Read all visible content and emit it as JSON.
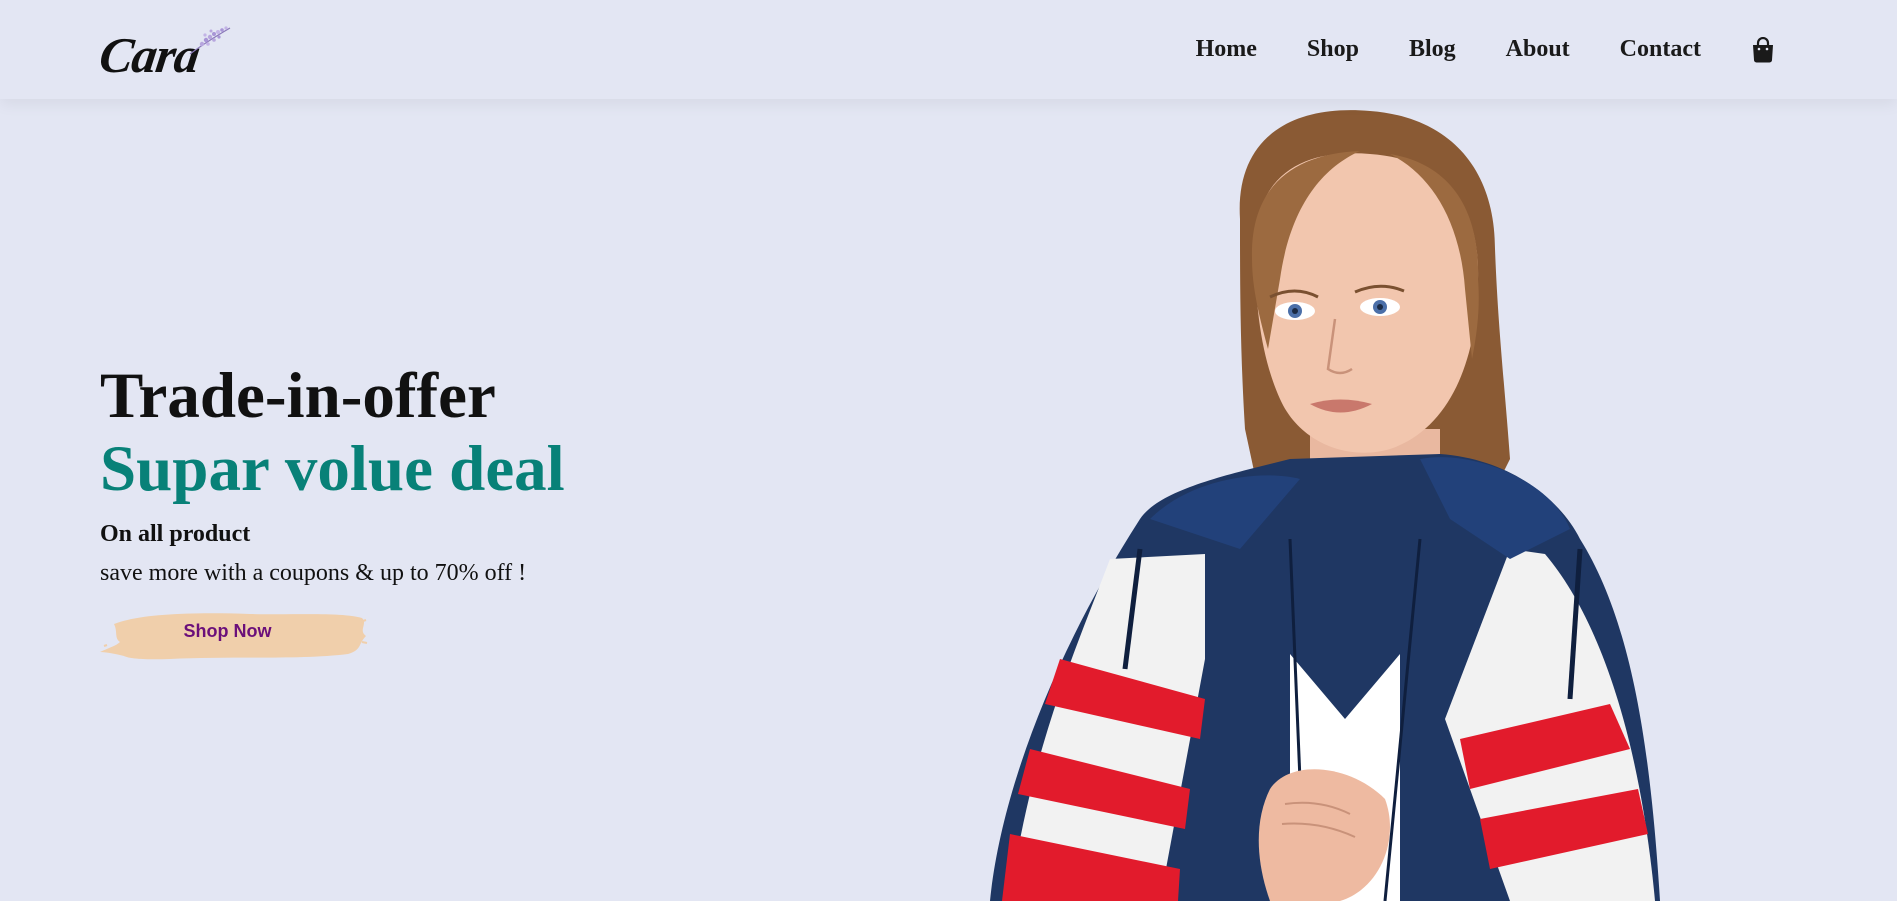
{
  "header": {
    "logo_text": "Cara",
    "nav": [
      {
        "label": "Home"
      },
      {
        "label": "Shop"
      },
      {
        "label": "Blog"
      },
      {
        "label": "About"
      },
      {
        "label": "Contact"
      }
    ],
    "cart_icon": "shopping-bag-icon"
  },
  "hero": {
    "kicker": "Trade-in-offer",
    "headline": "Supar volue deal",
    "subheading": "On all product",
    "description": "save more with a coupons & up to 70% off !",
    "cta_label": "Shop Now",
    "image": "model-in-navy-red-white-jacket"
  },
  "colors": {
    "background": "#e3e6f3",
    "accent_teal": "#088178",
    "button_brush": "#f0cfab",
    "button_text": "#6b0f7a",
    "text_dark": "#111111"
  }
}
